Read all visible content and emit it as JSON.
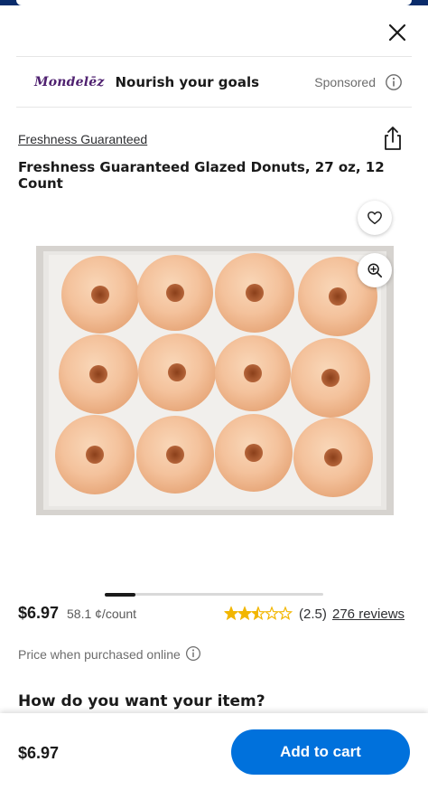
{
  "colors": {
    "accent": "#0071dc",
    "brand_purple": "#4f2170",
    "star": "#f2b600"
  },
  "sponsor": {
    "brand": "Mondelēz",
    "title": "Nourish your goals",
    "label": "Sponsored",
    "info_icon": "info-icon"
  },
  "product": {
    "brand_link": "Freshness Guaranteed",
    "title": "Freshness Guaranteed Glazed Donuts, 27 oz, 12 Count",
    "image_alt": "Box of 12 glazed donuts",
    "price": "$6.97",
    "unit_price": "58.1 ¢/count",
    "rating": "(2.5)",
    "rating_value": 2.5,
    "rating_max": 5,
    "reviews": "276 reviews",
    "online_note": "Price when purchased online"
  },
  "icons": {
    "close": "close-icon",
    "share": "share-icon",
    "heart": "heart-icon",
    "zoom": "zoom-in-icon"
  },
  "section": {
    "how_heading": "How do you want your item?"
  },
  "bottom": {
    "price": "$6.97",
    "cta": "Add to cart"
  }
}
